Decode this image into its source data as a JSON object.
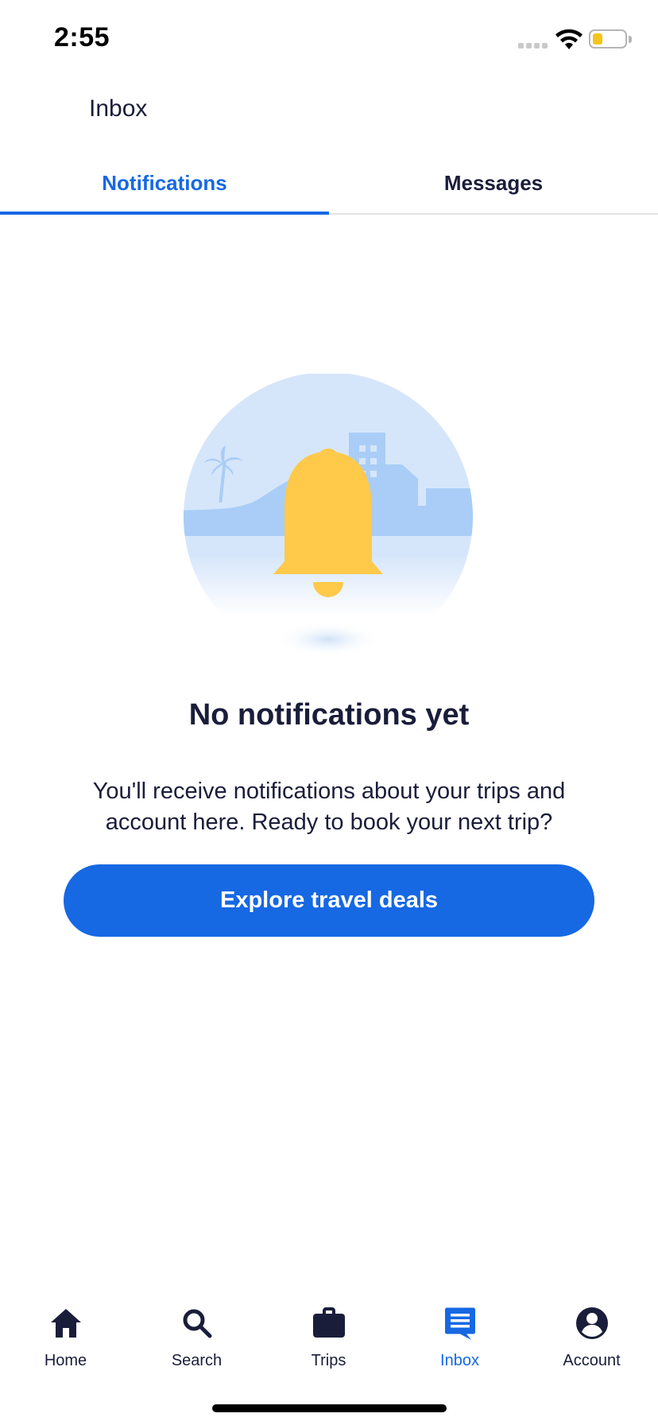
{
  "status_bar": {
    "time": "2:55"
  },
  "header": {
    "title": "Inbox"
  },
  "tabs": [
    {
      "label": "Notifications",
      "selected": true
    },
    {
      "label": "Messages",
      "selected": false
    }
  ],
  "empty_state": {
    "title": "No notifications yet",
    "body": "You'll receive notifications about your trips and account here. Ready to book your next trip?",
    "cta_label": "Explore travel deals",
    "illustration_icon": "bell-icon"
  },
  "bottom_nav": [
    {
      "label": "Home",
      "icon": "home-icon",
      "active": false
    },
    {
      "label": "Search",
      "icon": "search-icon",
      "active": false
    },
    {
      "label": "Trips",
      "icon": "briefcase-icon",
      "active": false
    },
    {
      "label": "Inbox",
      "icon": "message-icon",
      "active": true
    },
    {
      "label": "Account",
      "icon": "account-icon",
      "active": false
    }
  ],
  "colors": {
    "accent": "#1668e3",
    "text": "#1a1d3a",
    "bell": "#ffc94a",
    "illustration_sky": "#d6e6fa",
    "illustration_land": "#a9cdf7"
  }
}
